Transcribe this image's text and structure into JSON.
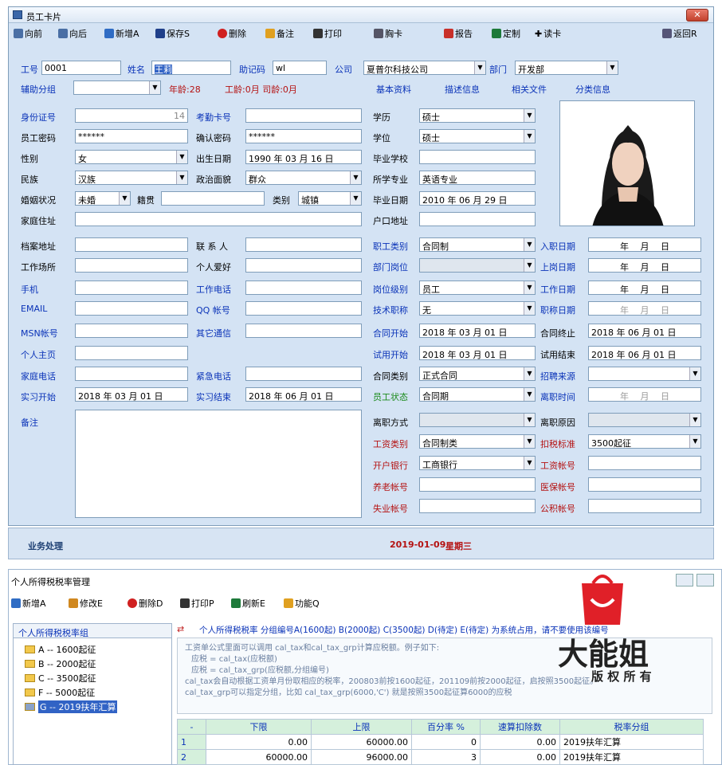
{
  "window": {
    "title": "员工卡片",
    "close": "✕"
  },
  "toolbar": {
    "items": [
      "向前",
      "向后",
      "新增A",
      "保存S",
      "删除",
      "备注",
      "打印",
      "胸卡",
      "报告",
      "定制",
      "读卡"
    ],
    "return": "返回R"
  },
  "row1": {
    "id_label": "工号",
    "id_value": "0001",
    "name_label": "姓名",
    "name_value": "王莉",
    "mnemonic_label": "助记码",
    "mnemonic_value": "wl",
    "company_label": "公司",
    "company_value": "夏普尔科技公司",
    "dept_label": "部门",
    "dept_value": "开发部"
  },
  "row2": {
    "group_label": "辅助分组",
    "age": "年龄:28",
    "work_age": "工龄:0月 司龄:0月",
    "tabs": [
      "基本资料",
      "描述信息",
      "相关文件",
      "分类信息"
    ]
  },
  "form": {
    "id_card_label": "身份证号",
    "id_card_value": "14",
    "attendance_label": "考勤卡号",
    "pwd_label": "员工密码",
    "pwd_value": "******",
    "confirm_label": "确认密码",
    "confirm_value": "******",
    "gender_label": "性别",
    "gender_value": "女",
    "birth_label": "出生日期",
    "birth_value": "1990 年 03 月 16 日",
    "nation_label": "民族",
    "nation_value": "汉族",
    "political_label": "政治面貌",
    "political_value": "群众",
    "marital_label": "婚姻状况",
    "marital_value": "未婚",
    "native_label": "籍贯",
    "type_label": "类别",
    "type_value": "城镇",
    "home_label": "家庭住址",
    "archive_label": "档案地址",
    "contact_label": "联 系 人",
    "workplace_label": "工作场所",
    "hobby_label": "个人爱好",
    "mobile_label": "手机",
    "workphone_label": "工作电话",
    "email_label": "EMAIL",
    "qq_label": "QQ 帐号",
    "msn_label": "MSN帐号",
    "other_label": "其它通信",
    "homepage_label": "个人主页",
    "homephone_label": "家庭电话",
    "emergency_label": "紧急电话",
    "intern_start_label": "实习开始",
    "intern_start_value": "2018 年 03 月 01 日",
    "intern_end_label": "实习结束",
    "intern_end_value": "2018 年 06 月 01 日",
    "remark_label": "备注",
    "edu_label": "学历",
    "edu_value": "硕士",
    "degree_label": "学位",
    "degree_value": "硕士",
    "school_label": "毕业学校",
    "major_label": "所学专业",
    "major_value": "英语专业",
    "grad_label": "毕业日期",
    "grad_value": "2010 年 06 月 29 日",
    "hukou_label": "户口地址",
    "jobtype_label": "职工类别",
    "jobtype_value": "合同制",
    "post_label": "部门岗位",
    "level_label": "岗位级别",
    "level_value": "员工",
    "title_label": "技术职称",
    "title_value": "无",
    "cstart_label": "合同开始",
    "cstart_value": "2018 年 03 月 01 日",
    "tstart_label": "试用开始",
    "tstart_value": "2018 年 03 月 01 日",
    "ctype_label": "合同类别",
    "ctype_value": "正式合同",
    "status_label": "员工状态",
    "status_value": "合同期",
    "leave_label": "离职方式",
    "salary_label": "工资类别",
    "salary_value": "合同制类",
    "bank_label": "开户银行",
    "bank_value": "工商银行",
    "pension_label": "养老帐号",
    "unemp_label": "失业帐号",
    "entry_label": "入职日期",
    "onpost_label": "上岗日期",
    "workdate_label": "工作日期",
    "titledate_label": "职称日期",
    "cend_label": "合同终止",
    "cend_value": "2018 年 06 月 01 日",
    "tend_label": "试用结束",
    "tend_value": "2018 年 06 月 01 日",
    "recruit_label": "招聘来源",
    "leavedate_label": "离职时间",
    "leavereason_label": "离职原因",
    "tax_label": "扣税标准",
    "tax_value": "3500起征",
    "salacc_label": "工资帐号",
    "medical_label": "医保帐号",
    "fund_label": "公积帐号",
    "date_blank": "年　 月　 日"
  },
  "bizbar": {
    "title": "业务处理",
    "date": "2019-01-09",
    "weekday": "星期三"
  },
  "taxwin": {
    "title": "个人所得税税率管理",
    "tools": [
      "新增A",
      "修改E",
      "删除D",
      "打印P",
      "刷新E",
      "功能Q"
    ],
    "tree_title": "个人所得税税率组",
    "tree": [
      "A -- 1600起征",
      "B -- 2000起征",
      "C -- 3500起征",
      "F -- 5000起征",
      "G -- 2019扶年汇算"
    ],
    "info_title": "个人所得税税率  分组编号A(1600起) B(2000起) C(3500起) D(待定) E(待定) 为系统占用，请不要使用该编号",
    "desc": [
      "工资单公式里面可以调用 cal_tax和cal_tax_grp计算应税额。例子如下:",
      "应税 = cal_tax(应税额)",
      "应税 = cal_tax_grp(应税额,分组编号)",
      "cal_tax会自动根据工资单月份取相应的税率，200803前按1600起征，201109前按2000起征，启按照3500起征。",
      "cal_tax_grp可以指定分组，比如 cal_tax_grp(6000,'C') 就是按照3500起征算6000的应税"
    ],
    "watermark": "大能姐",
    "watermark2": "版 权 所 有",
    "headers": [
      "-",
      "下限",
      "上限",
      "百分率 %",
      "速算扣除数",
      "税率分组"
    ],
    "rows": [
      [
        "1",
        "0.00",
        "60000.00",
        "0",
        "0.00",
        "2019扶年汇算"
      ],
      [
        "2",
        "60000.00",
        "96000.00",
        "3",
        "0.00",
        "2019扶年汇算"
      ]
    ]
  }
}
